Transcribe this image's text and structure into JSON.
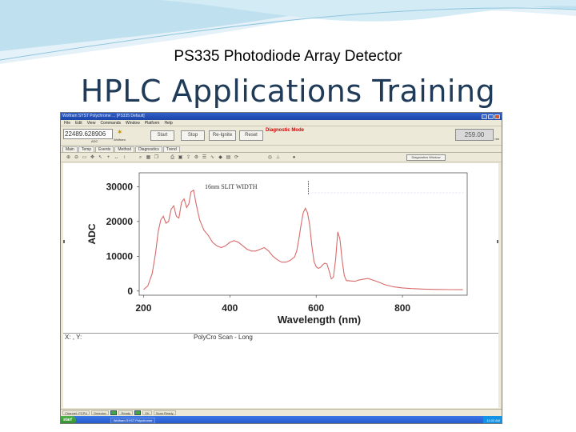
{
  "slide": {
    "subtitle": "PS335 Photodiode Array Detector",
    "title": "HPLC Applications Training"
  },
  "app": {
    "window_title": "Wolfram SYST Polychrome ... [PS335 Default]",
    "menu": [
      "File",
      "Edit",
      "View",
      "Commands",
      "Window",
      "Platform",
      "Help"
    ],
    "counter": {
      "value": "22489.628906",
      "sub": "ADC"
    },
    "logo": {
      "text": "Wolfram"
    },
    "buttons": {
      "start": "Start",
      "stop": "Stop",
      "re_ignite": "Re-Ignite",
      "reset": "Reset"
    },
    "diagnostic_mode": "Diagnostic Mode",
    "wavelength": {
      "value": "259.00",
      "unit": "nm"
    },
    "tabs": [
      "Main",
      "Temp",
      "Events",
      "Method",
      "Diagnostics",
      "Trend"
    ],
    "diagnostic_window_button": "Diagnostics Window",
    "info": {
      "xy_label": "X: , Y:",
      "mode": "PolyCro Scan - Long"
    },
    "status_bar": {
      "cell1": "Channel: PCPU",
      "cell2": "Detector:",
      "ready": "Ready",
      "ok": "OK",
      "scan": "Scan Ready"
    },
    "taskbar": {
      "start": "start",
      "task1": "Wolfram SYST Polychrome",
      "clock": "11:02 AM"
    }
  },
  "chart_data": {
    "type": "line",
    "annotation": "16nm SLIT WIDTH",
    "xlabel": "Wavelength (nm)",
    "ylabel": "ADC",
    "xlim": [
      190,
      950
    ],
    "ylim": [
      -1200,
      34000
    ],
    "x_ticks": [
      200,
      400,
      600,
      800
    ],
    "y_ticks": [
      0,
      10000,
      20000,
      30000
    ],
    "line_color": "#d86a6a",
    "grid": false,
    "series": [
      {
        "x": [
          200,
          210,
          220,
          228,
          234,
          240,
          246,
          252,
          258,
          264,
          270,
          276,
          282,
          288,
          294,
          300,
          305,
          310,
          316,
          322,
          330,
          340,
          350,
          360,
          370,
          380,
          390,
          400,
          410,
          420,
          430,
          440,
          450,
          460,
          470,
          480,
          490,
          500,
          510,
          520,
          530,
          540,
          550,
          555,
          560,
          565,
          570,
          575,
          580,
          585,
          590,
          595,
          600,
          605,
          610,
          615,
          620,
          625,
          630,
          635,
          640,
          645,
          650,
          655,
          660,
          665,
          670,
          680,
          690,
          700,
          720,
          740,
          760,
          780,
          800,
          820,
          850,
          880,
          910,
          940
        ],
        "y": [
          400,
          1500,
          5000,
          11000,
          17000,
          20500,
          21500,
          19500,
          20000,
          23500,
          24500,
          21500,
          21000,
          25500,
          26500,
          24000,
          25000,
          28500,
          29000,
          25000,
          20500,
          17500,
          16000,
          14000,
          13000,
          12500,
          13000,
          14000,
          14500,
          14000,
          13000,
          12000,
          11500,
          11500,
          12000,
          12500,
          11500,
          10000,
          9000,
          8300,
          8300,
          8800,
          9800,
          11500,
          15000,
          19000,
          22500,
          23800,
          22500,
          19000,
          13000,
          8500,
          7000,
          6500,
          6800,
          7500,
          8000,
          7800,
          5800,
          3500,
          4000,
          9000,
          17000,
          15000,
          9000,
          4500,
          3000,
          2900,
          2800,
          3200,
          3600,
          2800,
          1800,
          1200,
          900,
          700,
          550,
          450,
          400,
          380
        ]
      }
    ]
  }
}
